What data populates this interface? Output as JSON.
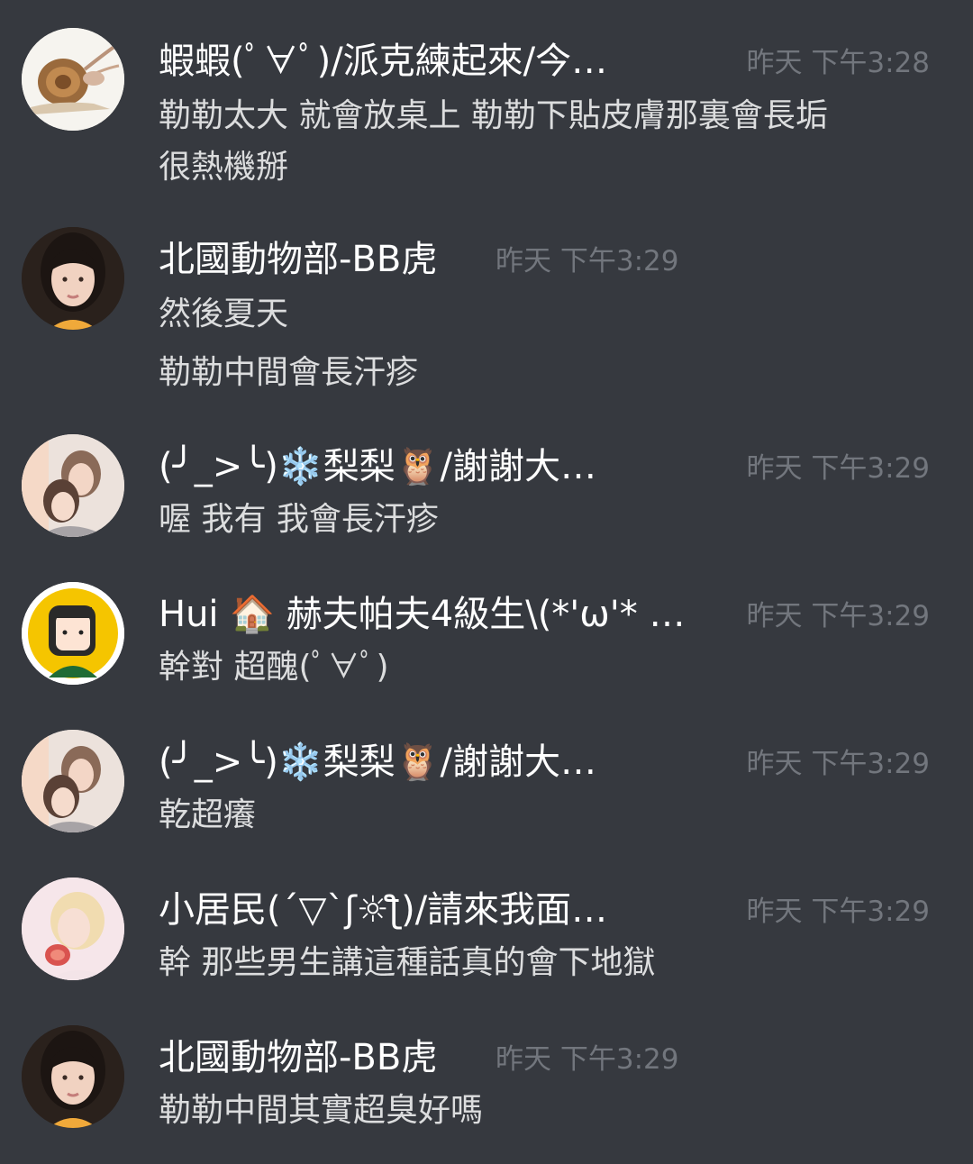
{
  "messages": [
    {
      "username": "蝦蝦(ﾟ∀ﾟ)/派克練起來/今…",
      "timestamp": "昨天 下午3:28",
      "avatar": "snail-shrimp-avatar",
      "lines": [
        "勒勒太大 就會放桌上 勒勒下貼皮膚那裏會長垢",
        "很熱機掰"
      ]
    },
    {
      "username": "北國動物部-BB虎",
      "timestamp": "昨天 下午3:29",
      "avatar": "girl-portrait-avatar",
      "lines": [
        "然後夏天",
        "勒勒中間會長汗疹"
      ]
    },
    {
      "username": "(╯_>╰)❄️梨梨🦉/謝謝大…",
      "timestamp": "昨天 下午3:29",
      "avatar": "two-girls-selfie-avatar",
      "lines": [
        "喔 我有 我會長汗疹"
      ]
    },
    {
      "username": "Hui 🏠 赫夫帕夫4級生\\(*'ω'* …",
      "timestamp": "昨天 下午3:29",
      "avatar": "cartoon-girl-avatar",
      "lines": [
        "幹對 超醜(ﾟ∀ﾟ)"
      ]
    },
    {
      "username": "(╯_>╰)❄️梨梨🦉/謝謝大…",
      "timestamp": "昨天 下午3:29",
      "avatar": "two-girls-selfie-avatar",
      "lines": [
        "乾超癢"
      ]
    },
    {
      "username": "小居民(´▽`ʃ☼ƪ)/請來我面…",
      "timestamp": "昨天 下午3:29",
      "avatar": "blonde-girl-avatar",
      "lines": [
        "幹  那些男生講這種話真的會下地獄"
      ]
    },
    {
      "username": "北國動物部-BB虎",
      "timestamp": "昨天 下午3:29",
      "avatar": "girl-portrait-avatar",
      "lines": [
        "勒勒中間其實超臭好嗎"
      ]
    }
  ]
}
